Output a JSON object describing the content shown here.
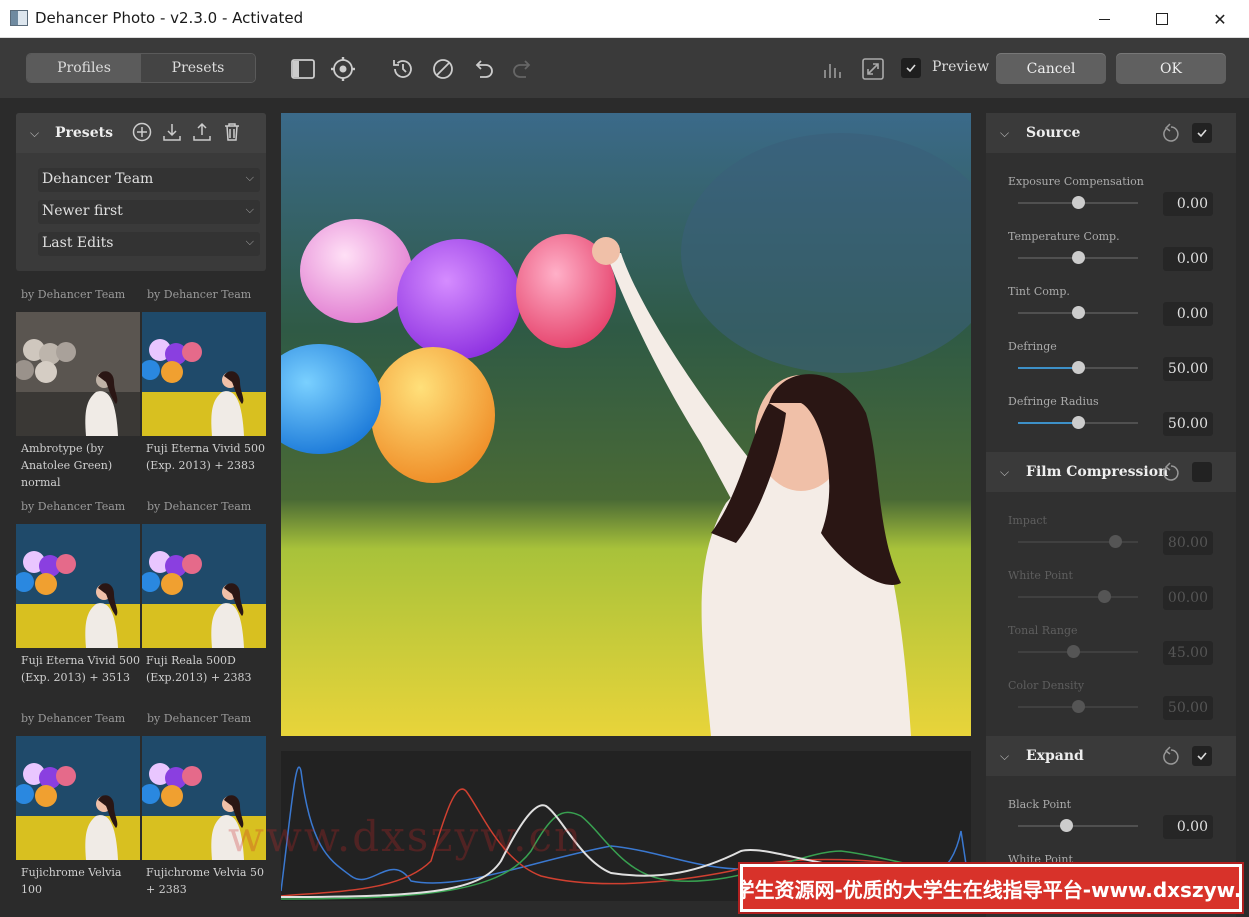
{
  "window": {
    "title": "Dehancer Photo - v2.3.0 - Activated"
  },
  "toolbar": {
    "tabs": [
      {
        "label": "Profiles",
        "active": true
      },
      {
        "label": "Presets",
        "active": false
      }
    ],
    "icons": [
      "panel-toggle-icon",
      "settings-icon",
      "history-icon",
      "disable-icon",
      "undo-icon",
      "redo-icon",
      "histogram-icon",
      "fullscreen-icon"
    ],
    "preview_label": "Preview",
    "preview_checked": true,
    "cancel_label": "Cancel",
    "ok_label": "OK"
  },
  "presets_panel": {
    "title": "Presets",
    "filters": [
      "Dehancer Team",
      "Newer first",
      "Last Edits"
    ],
    "author_label": "by Dehancer Team",
    "items": [
      {
        "label": "Ambrotype (by Anatolee Green) normal",
        "style": "sepia"
      },
      {
        "label": "Fuji Eterna Vivid 500 (Exp. 2013) + 2383",
        "style": "vivid"
      },
      {
        "label": "Fuji Eterna Vivid 500 (Exp. 2013) + 3513",
        "style": "vivid"
      },
      {
        "label": "Fuji Reala 500D (Exp.2013) + 2383",
        "style": "vivid"
      },
      {
        "label": "Fujichrome Velvia 100",
        "style": "vivid"
      },
      {
        "label": "Fujichrome Velvia 50 + 2383",
        "style": "vivid"
      }
    ]
  },
  "watermark": "www.dxszyw.cn",
  "banner": "大学生资源网-优质的大学生在线指导平台-www.dxszyw.cn",
  "right_panel": {
    "sections": [
      {
        "title": "Source",
        "enabled": true,
        "params": [
          {
            "label": "Exposure Compensation",
            "value": "0.00",
            "pos": 0.5,
            "dim": false
          },
          {
            "label": "Temperature Comp.",
            "value": "0.00",
            "pos": 0.5,
            "dim": false
          },
          {
            "label": "Tint Comp.",
            "value": "0.00",
            "pos": 0.5,
            "dim": false
          },
          {
            "label": "Defringe",
            "value": "50.00",
            "pos": 0.5,
            "dim": false
          },
          {
            "label": "Defringe Radius",
            "value": "50.00",
            "pos": 0.5,
            "dim": false
          }
        ]
      },
      {
        "title": "Film Compression",
        "enabled": false,
        "params": [
          {
            "label": "Impact",
            "value": "80.00",
            "pos": 0.8,
            "dim": true
          },
          {
            "label": "White Point",
            "value": "00.00",
            "pos": 0.72,
            "dim": true
          },
          {
            "label": "Tonal Range",
            "value": "45.00",
            "pos": 0.45,
            "dim": true
          },
          {
            "label": "Color Density",
            "value": "50.00",
            "pos": 0.5,
            "dim": true
          }
        ]
      },
      {
        "title": "Expand",
        "enabled": true,
        "params": [
          {
            "label": "Black Point",
            "value": "0.00",
            "pos": 0.4,
            "dim": false
          },
          {
            "label": "White Point",
            "value": "",
            "pos": 0.5,
            "dim": false
          }
        ]
      }
    ]
  }
}
